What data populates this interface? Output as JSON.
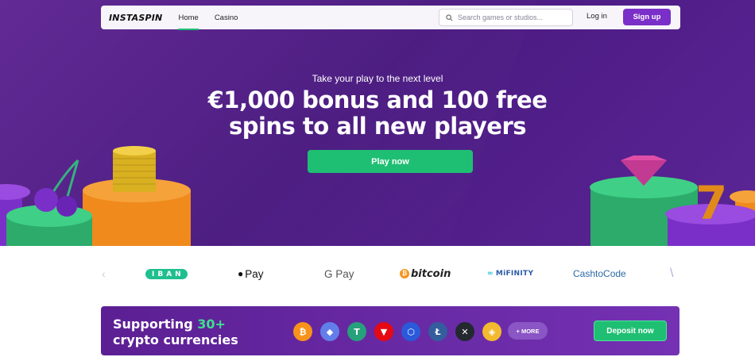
{
  "brand": {
    "logo": "INSTASPIN"
  },
  "nav": {
    "links": [
      "Home",
      "Casino"
    ],
    "search_placeholder": "Search games or studios...",
    "login_label": "Log in",
    "signup_label": "Sign up"
  },
  "hero": {
    "kicker": "Take your play to the next level",
    "headline": "€1,000 bonus and 100 free spins to all new players",
    "cta_label": "Play now"
  },
  "payments": {
    "items": [
      "IBAN",
      "Pay",
      "G Pay",
      "bitcoin",
      "MiFINITY",
      "CashtoCode"
    ]
  },
  "crypto": {
    "title_prefix": "Supporting ",
    "title_highlight": "30+",
    "title_line2": "crypto currencies",
    "coins": [
      {
        "name": "bitcoin-icon",
        "glyph": "₿",
        "color": "#f7931a"
      },
      {
        "name": "ethereum-icon",
        "glyph": "◆",
        "color": "#627eea"
      },
      {
        "name": "tether-icon",
        "glyph": "T",
        "color": "#26a17b"
      },
      {
        "name": "tron-icon",
        "glyph": "▼",
        "color": "#e50914"
      },
      {
        "name": "chainlink-icon",
        "glyph": "⬡",
        "color": "#2a5ada"
      },
      {
        "name": "litecoin-icon",
        "glyph": "Ł",
        "color": "#345d9d"
      },
      {
        "name": "xrp-icon",
        "glyph": "✕",
        "color": "#23292f"
      },
      {
        "name": "bnb-icon",
        "glyph": "◈",
        "color": "#f3ba2f"
      }
    ],
    "more_label": "+ MORE",
    "deposit_label": "Deposit now"
  },
  "colors": {
    "accent_green": "#1fbf73",
    "brand_purple": "#7b2fc9",
    "hero_bg": "#4a1a80"
  }
}
